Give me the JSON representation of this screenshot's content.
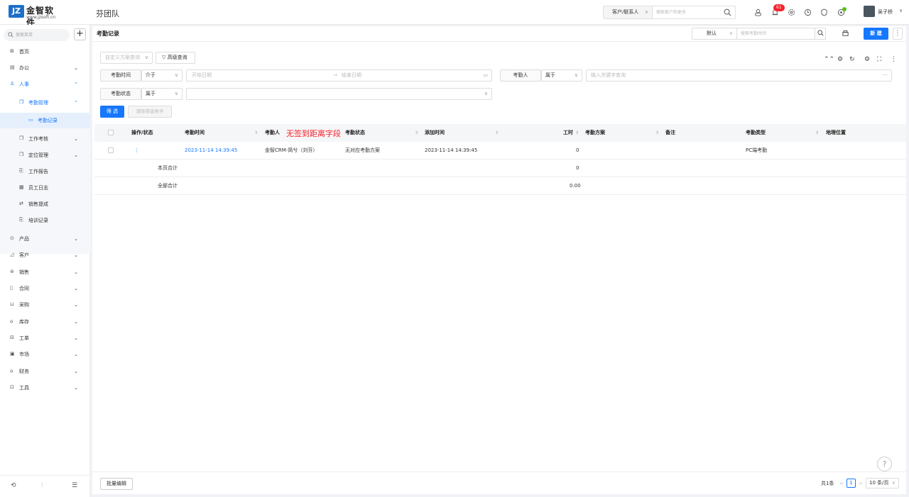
{
  "app": {
    "logo_mark": "JZ",
    "logo_name": "金智软件",
    "logo_url": "www.jzsoft.cn",
    "team": "芬团队"
  },
  "topbar": {
    "search_scope": "客户/联系人",
    "search_placeholder": "搜索客户和更多",
    "notifications": "61",
    "user": "吴子桥"
  },
  "sidebar": {
    "search_placeholder": "搜索菜单",
    "items": [
      {
        "label": "首页"
      },
      {
        "label": "办公"
      },
      {
        "label": "人事"
      },
      {
        "label": "考勤管理"
      },
      {
        "label": "考勤记录"
      },
      {
        "label": "工作考核"
      },
      {
        "label": "定位管理"
      },
      {
        "label": "工作报告"
      },
      {
        "label": "员工日志"
      },
      {
        "label": "销售提成"
      },
      {
        "label": "培训记录"
      },
      {
        "label": "产品"
      },
      {
        "label": "客户"
      },
      {
        "label": "销售"
      },
      {
        "label": "合同"
      },
      {
        "label": "采购"
      },
      {
        "label": "库存"
      },
      {
        "label": "工单"
      },
      {
        "label": "市场"
      },
      {
        "label": "财务"
      },
      {
        "label": "工具"
      }
    ]
  },
  "main": {
    "title": "考勤记录",
    "view": "默认",
    "search_placeholder": "搜索考勤时间",
    "new_label": "新 建",
    "custom_query": "自定义方案查询",
    "advanced": "高级查询",
    "filters": {
      "time_label": "考勤时间",
      "time_op": "介于",
      "start_ph": "开始日期",
      "end_ph": "结束日期",
      "person_label": "考勤人",
      "person_op": "属于",
      "person_ph": "输入关键字查询",
      "status_label": "考勤状态",
      "status_op": "属于"
    },
    "filter_btn": "筛 选",
    "clear_btn": "清除筛选条件",
    "columns": [
      "操作/状态",
      "考勤时间",
      "考勤人",
      "考勤状态",
      "添加时间",
      "工时",
      "考勤方案",
      "备注",
      "考勤类型",
      "地理位置"
    ],
    "annotation": "无签到距离字段",
    "rows": [
      {
        "time": "2023-11-14 14:39:45",
        "person": "金智CRM-简兮（刘芬）",
        "status": "无对应考勤方案",
        "added": "2023-11-14 14:39:45",
        "hours": "0",
        "type": "PC端考勤"
      }
    ],
    "page_total_label": "本页合计",
    "page_total": "0",
    "all_total_label": "全部合计",
    "all_total": "0.00",
    "batch_edit": "批量编辑",
    "pager": {
      "total": "共1条",
      "current": "1",
      "size": "10 条/页"
    }
  }
}
